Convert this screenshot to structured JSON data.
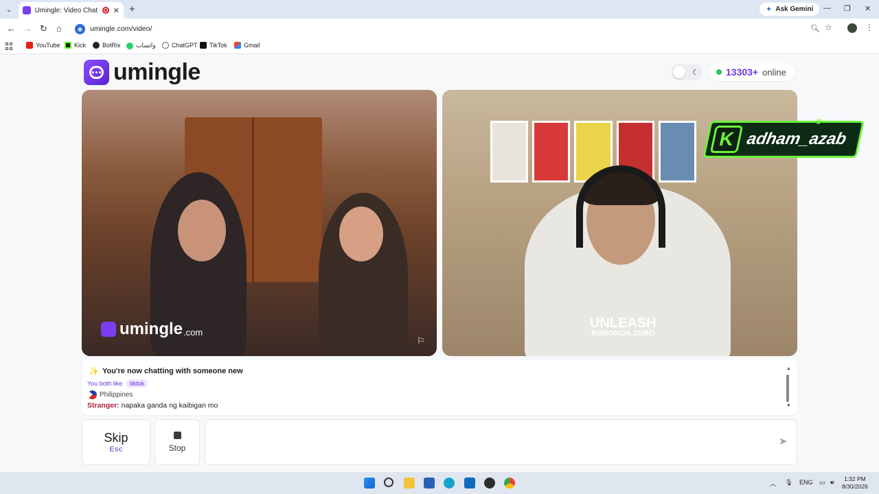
{
  "browser": {
    "tab_title": "Umingle: Video Chat with S",
    "new_tab": "+",
    "ask_gemini": "Ask Gemini",
    "url": "umingle.com/video/",
    "bookmarks": [
      "YouTube",
      "Kick",
      "BotRix",
      "واتساب",
      "ChatGPT",
      "TikTok",
      "Gmail"
    ]
  },
  "page": {
    "logo_text": "umingle",
    "online_count": "13303+",
    "online_label": "online",
    "watermark_text": "umingle",
    "watermark_domain": ".com",
    "streamer_badge_initial": "K",
    "streamer_name": "adham_azab",
    "shirt_text": "UNLEASH",
    "shirt_subtext": "RORONOA ZORO"
  },
  "chat": {
    "new_chat": "You're now chatting with someone new",
    "both_like": "You both like",
    "interest": "tiktok",
    "country": "Philippines",
    "stranger_label": "Stranger:",
    "stranger_message": "napaka ganda ng kaibigan mo"
  },
  "controls": {
    "skip_label": "Skip",
    "skip_key": "Esc",
    "stop_label": "Stop",
    "message_placeholder": ""
  },
  "taskbar": {
    "lang": "ENG",
    "time": "1:32 PM",
    "date": "8/30/2026"
  },
  "colors": {
    "brand": "#6a35e0",
    "online": "#22c55e",
    "stranger": "#b0203b",
    "badge_green": "#6cf23a"
  }
}
